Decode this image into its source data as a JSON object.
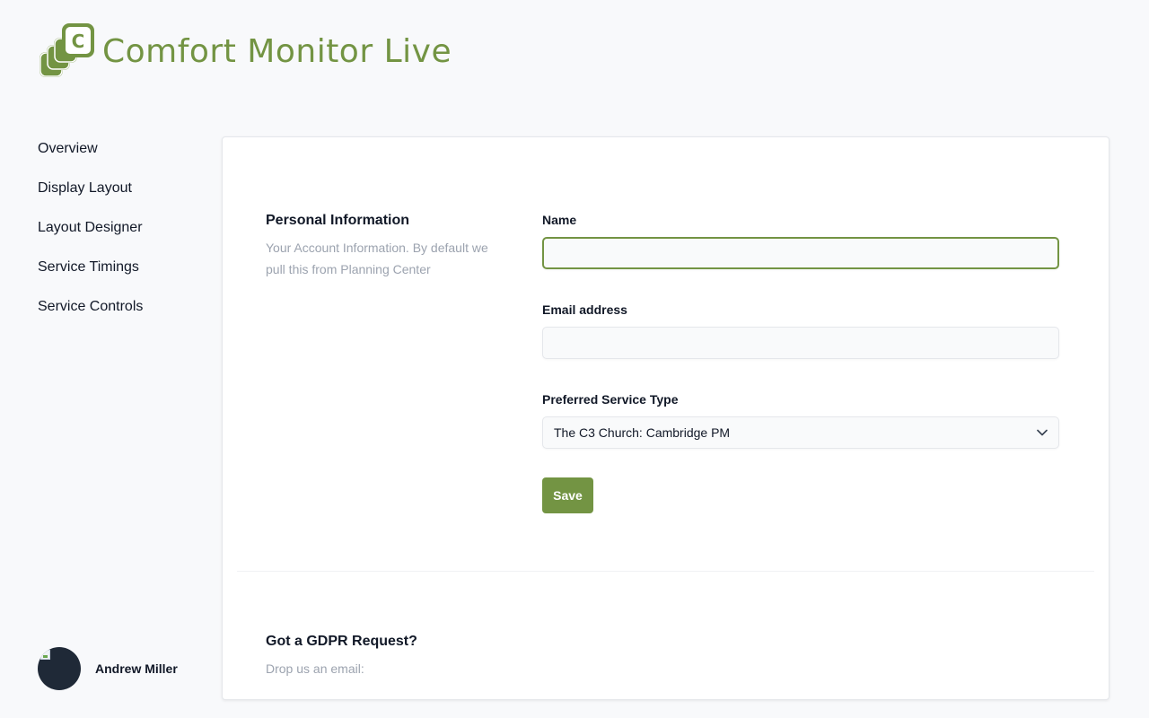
{
  "app": {
    "title": "Comfort Monitor Live",
    "logo_letter": "C",
    "brand_color": "#739443"
  },
  "sidebar": {
    "items": [
      {
        "label": "Overview"
      },
      {
        "label": "Display Layout"
      },
      {
        "label": "Layout Designer"
      },
      {
        "label": "Service Timings"
      },
      {
        "label": "Service Controls"
      }
    ]
  },
  "user": {
    "name": "Andrew Miller"
  },
  "personal": {
    "title": "Personal Information",
    "description": "Your Account Information. By default we pull this from Planning Center",
    "name_label": "Name",
    "name_value": "",
    "email_label": "Email address",
    "email_value": "",
    "service_type_label": "Preferred Service Type",
    "service_type_value": "The C3 Church: Cambridge PM",
    "save_label": "Save"
  },
  "gdpr": {
    "title": "Got a GDPR Request?",
    "description": "Drop us an email:"
  }
}
